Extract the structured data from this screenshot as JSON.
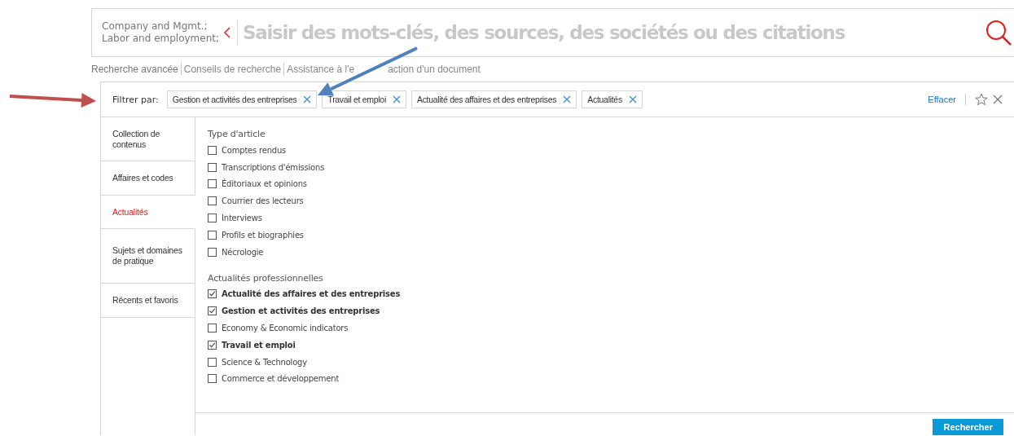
{
  "search": {
    "scope_lines": [
      "Company and Mgmt.;",
      "Labor and employment;"
    ],
    "placeholder": "Saisir des mots-clés, des sources, des sociétés ou des citations"
  },
  "links": [
    {
      "label": "Recherche avancée",
      "selected": true
    },
    {
      "label": "Conseils de recherche",
      "selected": false
    },
    {
      "label": "Assistance à l'e",
      "label_rest": "action d'un document",
      "selected": false
    }
  ],
  "filter_bar": {
    "label": "Filtrer par:",
    "chips": [
      "Gestion et activités des entreprises",
      "Travail et emploi",
      "Actualité des affaires et des entreprises",
      "Actualités"
    ],
    "clear": "Effacer"
  },
  "sidebar": {
    "items": [
      {
        "label": "Collection de contenus",
        "selected": false
      },
      {
        "label": "Affaires et codes",
        "selected": false
      },
      {
        "label": "Actualités",
        "selected": true
      },
      {
        "label": "Sujets et domaines de pratique",
        "selected": false
      },
      {
        "label": "Récents et favoris",
        "selected": false
      }
    ]
  },
  "groups": [
    {
      "title": "Type d'article",
      "options": [
        {
          "label": "Comptes rendus",
          "checked": false
        },
        {
          "label": "Transcriptions d'émissions",
          "checked": false
        },
        {
          "label": "Éditoriaux et opinions",
          "checked": false
        },
        {
          "label": "Courrier des lecteurs",
          "checked": false
        },
        {
          "label": "Interviews",
          "checked": false
        },
        {
          "label": "Profils et biographies",
          "checked": false
        },
        {
          "label": "Nécrologie",
          "checked": false
        }
      ]
    },
    {
      "title": "Actualités professionnelles",
      "options": [
        {
          "label": "Actualité des affaires et des entreprises",
          "checked": true
        },
        {
          "label": "Gestion et activités des entreprises",
          "checked": true
        },
        {
          "label": "Economy & Economic indicators",
          "checked": false
        },
        {
          "label": "Travail et emploi",
          "checked": true
        },
        {
          "label": "Science & Technology",
          "checked": false
        },
        {
          "label": "Commerce et développement",
          "checked": false
        }
      ]
    }
  ],
  "search_button": "Rechercher",
  "annotations": [
    {
      "kind": "arrow",
      "color": "#c0504d"
    },
    {
      "kind": "arrow",
      "color": "#4f81bd"
    }
  ]
}
